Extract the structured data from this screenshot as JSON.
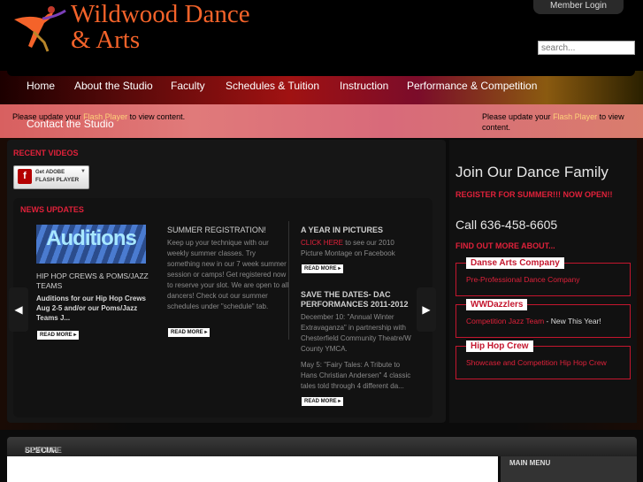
{
  "header": {
    "logo_line1": "Wildwood Dance",
    "logo_line2": "& Arts",
    "member_login": "Member Login",
    "search_placeholder": "search..."
  },
  "nav": {
    "items": [
      "Home",
      "About the Studio",
      "Faculty",
      "Schedules & Tuition",
      "Instruction",
      "Performance & Competition",
      "Contact the Studio"
    ]
  },
  "flash_notice": {
    "prefix": "Please update your ",
    "link": "Flash Player",
    "suffix": " to view content."
  },
  "recent_videos": {
    "heading": "RECENT VIDEOS",
    "badge_line1": "Get ADOBE",
    "badge_line2": "FLASH PLAYER"
  },
  "news": {
    "heading": "NEWS UPDATES",
    "image_text": "Auditions",
    "items": [
      {
        "title": "HIP HOP CREWS & POMS/JAZZ TEAMS",
        "body": "Auditions for our Hip Hop Crews Aug 2-5 and/or our Poms/Jazz Teams J...",
        "read_more": "READ MORE"
      },
      {
        "title": "SUMMER REGISTRATION!",
        "body": "Keep up your technique with our weekly summer classes.  Try something new in our 7 week summer session or camps! Get registered now to reserve your slot.  We are open to all dancers! Check out our summer schedules under \"schedule\" tab.",
        "read_more": "READ MORE"
      },
      {
        "title": "A YEAR IN PICTURES",
        "link": "CLICK HERE",
        "body": " to see our 2010 Picture Montage on Facebook",
        "read_more": "READ MORE"
      },
      {
        "title": "SAVE THE DATES- DAC PERFORMANCES 2011-2012",
        "body": "December 10: \"Annual Winter Extravaganza\" in partnership with Chesterfield Community Theatre/W County YMCA.",
        "body2": "May 5: \"Fairy Tales: A Tribute to Hans Christian Andersen\" 4 classic tales told through 4 different da...",
        "read_more": "READ MORE"
      }
    ]
  },
  "sidebar": {
    "join": "Join Our Dance Family",
    "register": "REGISTER FOR SUMMER!!! NOW OPEN!!",
    "call": "Call 636-458-6605",
    "find_out": "FIND OUT MORE ABOUT...",
    "boxes": [
      {
        "tag": "Danse Arts Company",
        "link": "Pre-Professional Dance Company",
        "extra": ""
      },
      {
        "tag": "WWDazzlers",
        "link": "Competition Jazz Team",
        "extra": " - New This Year!"
      },
      {
        "tag": "Hip Hop Crew",
        "link": "Showcase and Competition Hip Hop Crew",
        "extra": ""
      }
    ]
  },
  "special": {
    "part1": "SPECIAL",
    "part2": " FEATURE"
  },
  "main_menu": "MAIN MENU",
  "colors": {
    "accent_red": "#e0213a",
    "logo_orange": "#f4632a"
  }
}
